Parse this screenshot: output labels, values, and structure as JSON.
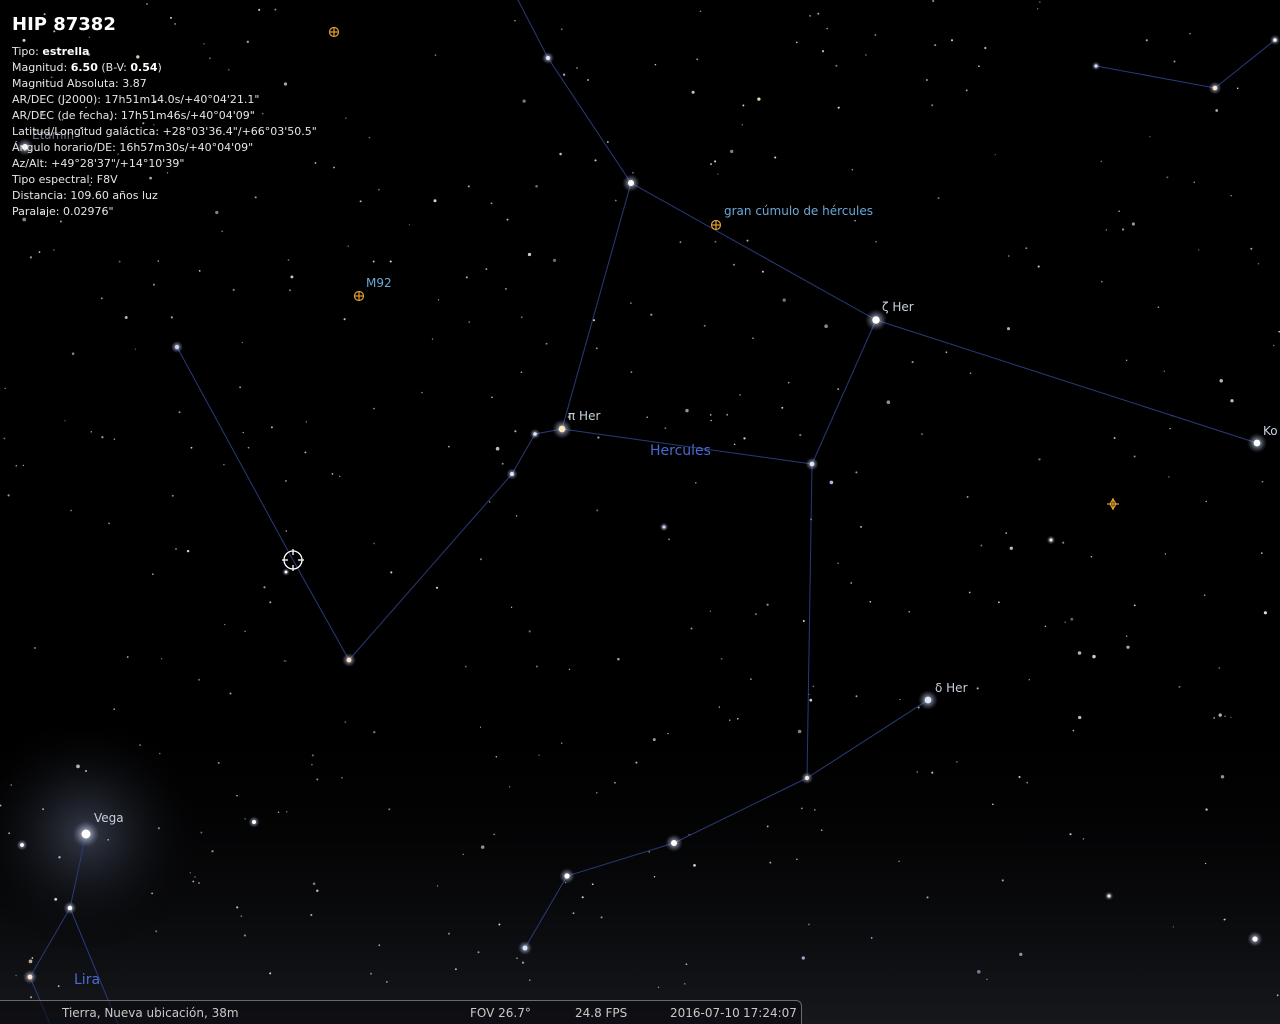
{
  "selected_object": {
    "title": "HIP 87382",
    "type_label": "Tipo: ",
    "type_value": "estrella",
    "magnitude_label": "Magnitud: ",
    "magnitude_value": "6.50",
    "bv_label": " (B-V: ",
    "bv_value": "0.54",
    "bv_close": ")",
    "absolute_magnitude": "Magnitud Absoluta: 3.87",
    "radec_j2000": "AR/DEC (J2000): 17h51m14.0s/+40°04'21.1\"",
    "radec_date": "AR/DEC (de fecha): 17h51m46s/+40°04'09\"",
    "galactic": "Latitud/Longitud galáctica: +28°03'36.4\"/+66°03'50.5\"",
    "hour_angle": "Ángulo horario/DE: 16h57m30s/+40°04'09\"",
    "azalt": "Az/Alt: +49°28'37\"/+14°10'39\"",
    "spectral_type": "Tipo espectral: F8V",
    "distance": "Distancia: 109.60 años luz",
    "parallax": "Paralaje: 0.02976\""
  },
  "sky_labels": {
    "hercules": "Hercules",
    "lira": "Lira",
    "vega": "Vega",
    "zeta_her": "ζ Her",
    "pi_her": "π Her",
    "delta_her": "δ Her",
    "kornephoros_partial": "Ko",
    "great_cluster": "gran cúmulo de hércules",
    "m92": "M92",
    "eltanin_partial": "Etamin"
  },
  "status_bar": {
    "location": "Tierra, Nueva ubicación, 38m",
    "fov": "FOV 26.7°",
    "fps": "24.8 FPS",
    "date": "2016-07-10",
    "time": "17:24:07"
  },
  "colors": {
    "background": "#000000",
    "constellation_line": "#2a3a7a",
    "constellation_label": "#4a6ad0",
    "deep_sky_marker": "#e0a030",
    "deep_sky_label": "#6aa8d8",
    "star_label": "#c8d0e0",
    "selection_marker": "#ffffff"
  }
}
